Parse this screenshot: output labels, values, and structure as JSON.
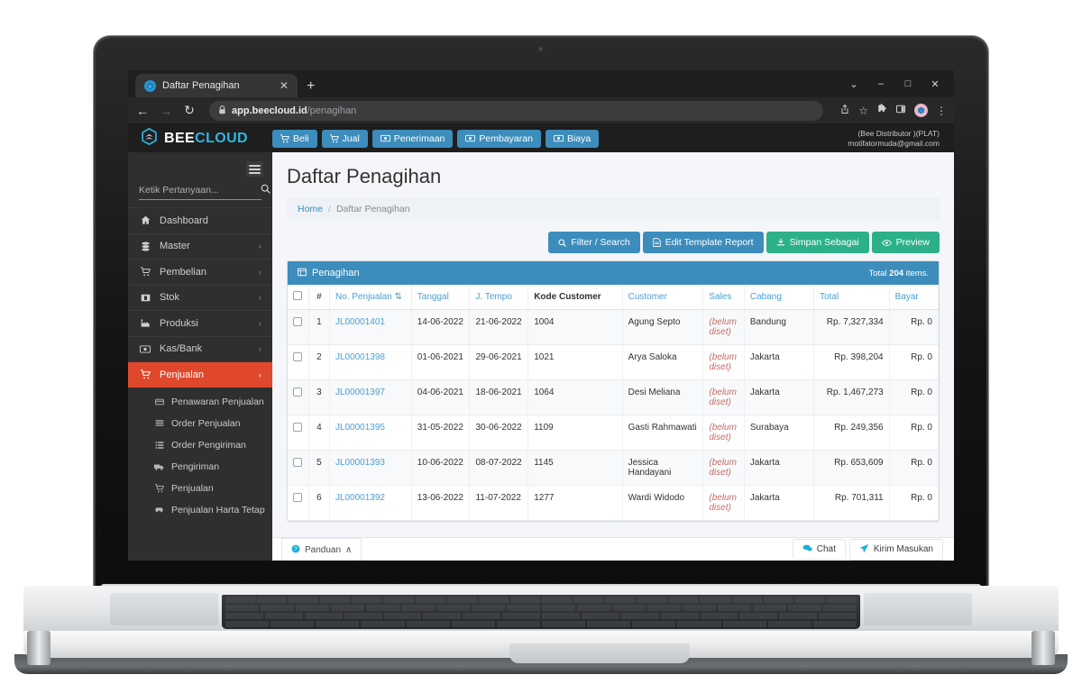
{
  "browser": {
    "tab": {
      "title": "Daftar Penagihan",
      "favicon": "beecloud-icon",
      "close": "✕"
    },
    "new_tab": "+",
    "window_controls": {
      "minimize_chevron": "⌄",
      "minimize": "–",
      "maximize": "□",
      "close": "✕"
    },
    "nav": {
      "back": "←",
      "forward": "→",
      "reload": "↻"
    },
    "omnibox": {
      "lock": "🔒",
      "domain": "app.beecloud.id",
      "path": "/penagihan"
    },
    "toolbar_right": {
      "share": "⤴",
      "bookmark": "☆",
      "extensions": "🧩",
      "sidepanel": "▣",
      "profile": "●",
      "menu": "⋮"
    }
  },
  "app": {
    "brand": {
      "bee": "BEE",
      "cloud": "CLOUD",
      "logo": "beecloud-hexagon-logo"
    },
    "topnav": [
      {
        "label": "Beli",
        "icon": "cart-icon"
      },
      {
        "label": "Jual",
        "icon": "cart-icon"
      },
      {
        "label": "Penerimaan",
        "icon": "money-icon"
      },
      {
        "label": "Pembayaran",
        "icon": "money-icon"
      },
      {
        "label": "Biaya",
        "icon": "money-icon"
      }
    ],
    "user": {
      "company": "(Bee Distributor )(PLAT)",
      "email": "motifatormuda@gmail.com"
    }
  },
  "sidebar": {
    "hamburger": "menu-icon",
    "search": {
      "placeholder": "Ketik Pertanyaan...",
      "value": "",
      "icon": "search-icon"
    },
    "items": [
      {
        "label": "Dashboard",
        "icon": "home-icon",
        "caret": "",
        "active": false
      },
      {
        "label": "Master",
        "icon": "database-icon",
        "caret": "‹",
        "active": false
      },
      {
        "label": "Pembelian",
        "icon": "cart-icon",
        "caret": "‹",
        "active": false
      },
      {
        "label": "Stok",
        "icon": "box-icon",
        "caret": "‹",
        "active": false
      },
      {
        "label": "Produksi",
        "icon": "factory-icon",
        "caret": "‹",
        "active": false
      },
      {
        "label": "Kas/Bank",
        "icon": "money-icon",
        "caret": "‹",
        "active": false
      },
      {
        "label": "Penjualan",
        "icon": "cart-icon",
        "caret": "‹",
        "active": true
      }
    ],
    "submenu": [
      {
        "label": "Penawaran Penjualan",
        "icon": "card-icon"
      },
      {
        "label": "Order Penjualan",
        "icon": "list-icon"
      },
      {
        "label": "Order Pengiriman",
        "icon": "list-alt-icon"
      },
      {
        "label": "Pengiriman",
        "icon": "truck-icon"
      },
      {
        "label": "Penjualan",
        "icon": "cart-icon"
      },
      {
        "label": "Penjualan Harta Tetap",
        "icon": "car-icon"
      }
    ]
  },
  "page": {
    "title": "Daftar Penagihan",
    "breadcrumb": {
      "home": "Home",
      "sep": "/",
      "current": "Daftar Penagihan"
    },
    "actions": [
      {
        "label": "Filter / Search",
        "icon": "search-icon",
        "style": "blue"
      },
      {
        "label": "Edit Template Report",
        "icon": "file-icon",
        "style": "blue"
      },
      {
        "label": "Simpan Sebagai",
        "icon": "download-icon",
        "style": "green"
      },
      {
        "label": "Preview",
        "icon": "eye-icon",
        "style": "green"
      }
    ],
    "panel": {
      "title": "Penagihan",
      "icon": "table-icon",
      "total_prefix": "Total",
      "total_count": "204",
      "total_suffix": "items."
    }
  },
  "table": {
    "columns": [
      {
        "label": "",
        "key": "checkbox"
      },
      {
        "label": "#",
        "key": "num"
      },
      {
        "label": "No. Penjualan",
        "key": "no",
        "sort_icon": "sort-icon"
      },
      {
        "label": "Tanggal",
        "key": "tanggal"
      },
      {
        "label": "J. Tempo",
        "key": "tempo"
      },
      {
        "label": "Kode Customer",
        "key": "kode",
        "bold": true
      },
      {
        "label": "Customer",
        "key": "customer"
      },
      {
        "label": "Sales",
        "key": "sales"
      },
      {
        "label": "Cabang",
        "key": "cabang"
      },
      {
        "label": "Total",
        "key": "total"
      },
      {
        "label": "Bayar",
        "key": "bayar"
      }
    ],
    "rows": [
      {
        "num": "1",
        "no": "JL00001401",
        "tanggal": "14-06-2022",
        "tempo": "21-06-2022",
        "kode": "1004",
        "customer": "Agung Septo",
        "sales": "(belum diset)",
        "cabang": "Bandung",
        "total": "Rp. 7,327,334",
        "bayar": "Rp. 0"
      },
      {
        "num": "2",
        "no": "JL00001398",
        "tanggal": "01-06-2021",
        "tempo": "29-06-2021",
        "kode": "1021",
        "customer": "Arya Saloka",
        "sales": "(belum diset)",
        "cabang": "Jakarta",
        "total": "Rp. 398,204",
        "bayar": "Rp. 0"
      },
      {
        "num": "3",
        "no": "JL00001397",
        "tanggal": "04-06-2021",
        "tempo": "18-06-2021",
        "kode": "1064",
        "customer": "Desi Meliana",
        "sales": "(belum diset)",
        "cabang": "Jakarta",
        "total": "Rp. 1,467,273",
        "bayar": "Rp. 0"
      },
      {
        "num": "4",
        "no": "JL00001395",
        "tanggal": "31-05-2022",
        "tempo": "30-06-2022",
        "kode": "1109",
        "customer": "Gasti Rahmawati",
        "sales": "(belum diset)",
        "cabang": "Surabaya",
        "total": "Rp. 249,356",
        "bayar": "Rp. 0"
      },
      {
        "num": "5",
        "no": "JL00001393",
        "tanggal": "10-06-2022",
        "tempo": "08-07-2022",
        "kode": "1145",
        "customer": "Jessica Handayani",
        "sales": "(belum diset)",
        "cabang": "Jakarta",
        "total": "Rp. 653,609",
        "bayar": "Rp. 0"
      },
      {
        "num": "6",
        "no": "JL00001392",
        "tanggal": "13-06-2022",
        "tempo": "11-07-2022",
        "kode": "1277",
        "customer": "Wardi Widodo",
        "sales": "(belum diset)",
        "cabang": "Jakarta",
        "total": "Rp. 701,311",
        "bayar": "Rp. 0"
      }
    ]
  },
  "footer": {
    "panduan": {
      "label": "Panduan",
      "icon": "question-icon",
      "caret": "∧"
    },
    "chat": {
      "label": "Chat",
      "icon": "chat-icon"
    },
    "kirim": {
      "label": "Kirim Masukan",
      "icon": "send-icon"
    }
  },
  "colors": {
    "brand_blue": "#3c8dbc",
    "brand_cyan": "#2eb6e0",
    "accent_red": "#e0482c",
    "green": "#2cb08a",
    "sidebar_bg": "#2f2f2f",
    "link": "#4a9fd4",
    "unset_red": "#c86a6a"
  }
}
